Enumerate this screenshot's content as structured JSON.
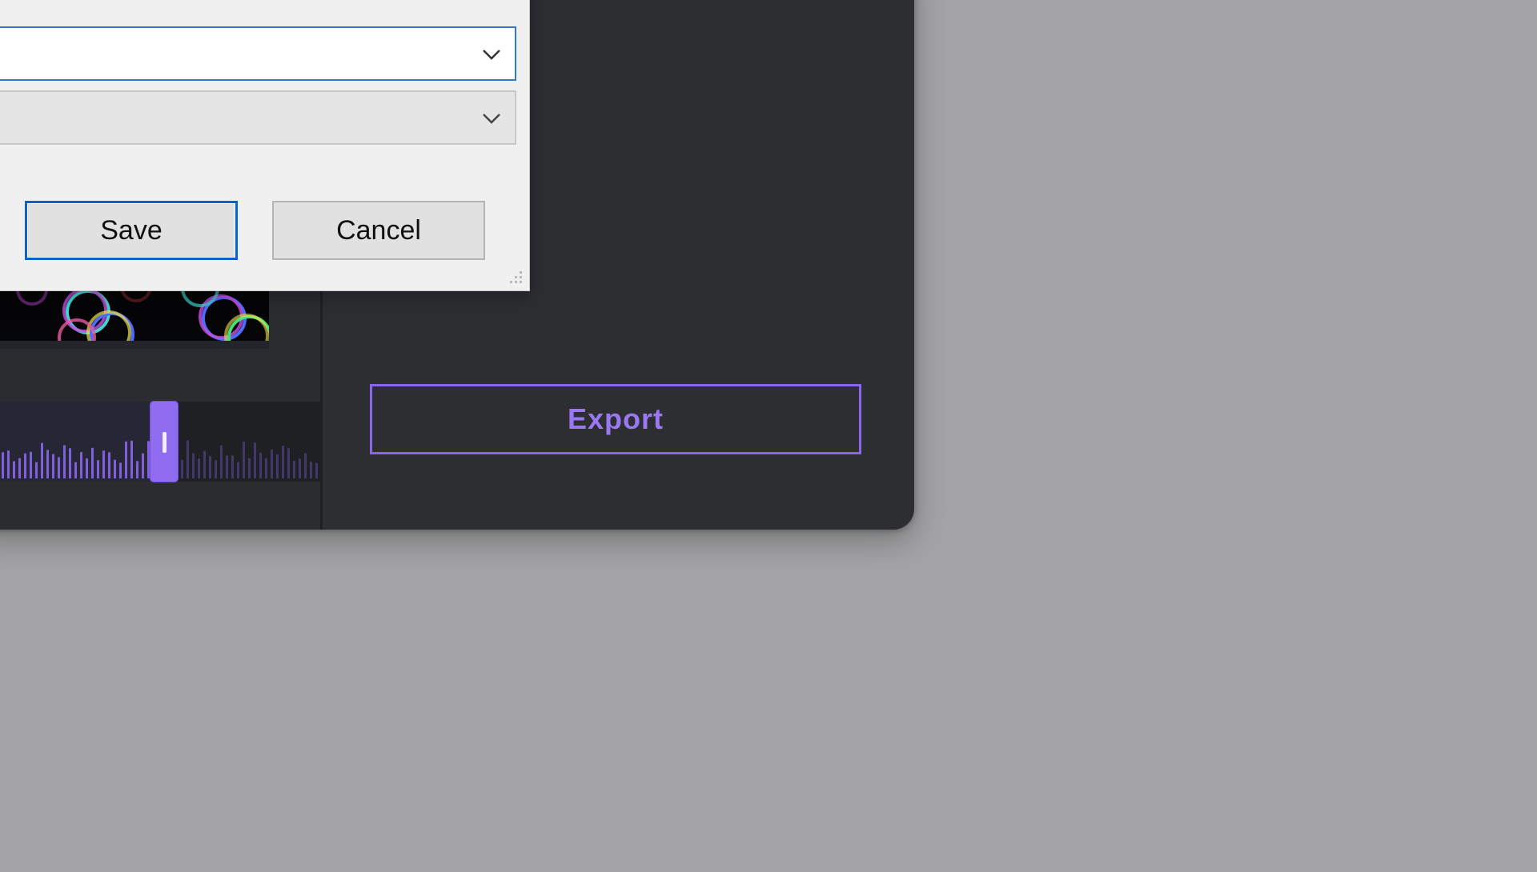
{
  "dialog": {
    "filename_value": "",
    "filetype_value": "",
    "save_label": "Save",
    "cancel_label": "Cancel",
    "icons": {
      "filename_dropdown": "chevron-down-icon",
      "filetype_dropdown": "chevron-down-icon",
      "resize": "resize-grip-icon"
    }
  },
  "editor": {
    "export_label": "Export",
    "playhead_position": 0.5
  },
  "colors": {
    "accent": "#8a66ee",
    "dialog_focus": "#0a64c8",
    "app_background": "#2d2e32",
    "desktop": "#a4a4a6"
  }
}
